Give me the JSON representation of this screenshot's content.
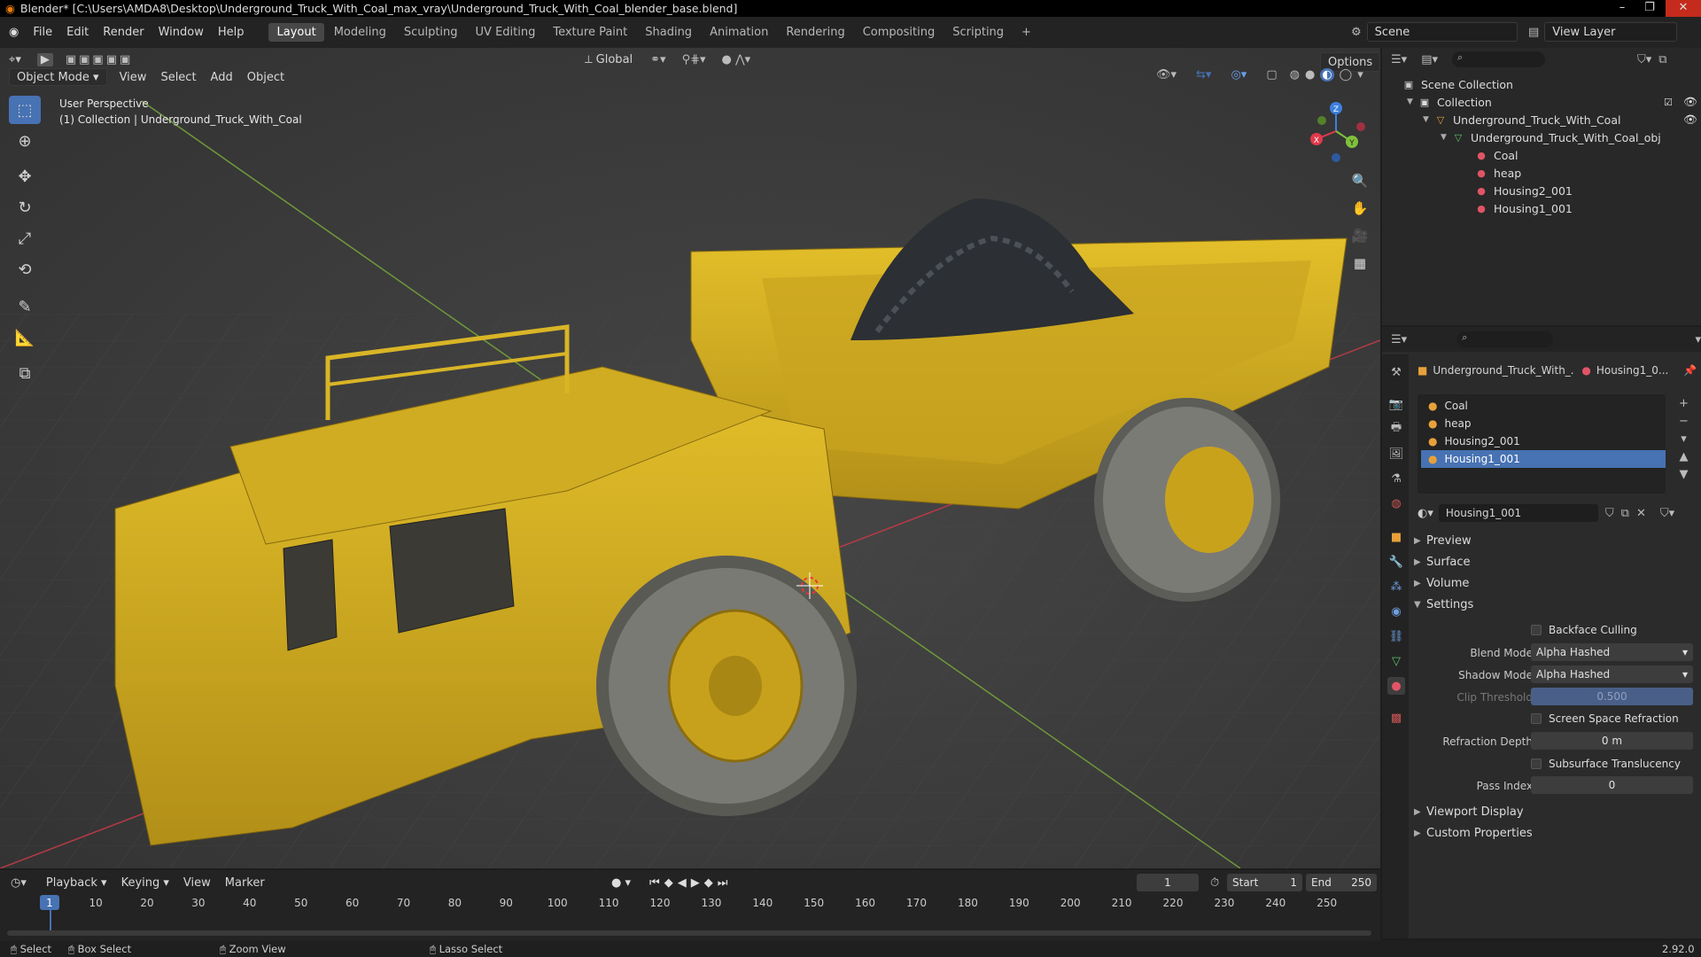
{
  "titlebar": {
    "title": "Blender* [C:\\Users\\AMDA8\\Desktop\\Underground_Truck_With_Coal_max_vray\\Underground_Truck_With_Coal_blender_base.blend]"
  },
  "menu": [
    "File",
    "Edit",
    "Render",
    "Window",
    "Help"
  ],
  "workspaces": [
    "Layout",
    "Modeling",
    "Sculpting",
    "UV Editing",
    "Texture Paint",
    "Shading",
    "Animation",
    "Rendering",
    "Compositing",
    "Scripting"
  ],
  "active_workspace": "Layout",
  "scene": "Scene",
  "view_layer": "View Layer",
  "viewport": {
    "mode": "Object Mode",
    "menus": [
      "View",
      "Select",
      "Add",
      "Object"
    ],
    "orientation": "Global",
    "options": "Options",
    "overlay_line1": "User Perspective",
    "overlay_line2": "(1) Collection | Underground_Truck_With_Coal",
    "gizmo": {
      "x": "X",
      "y": "Y",
      "z": "Z"
    }
  },
  "outliner": {
    "root": "Scene Collection",
    "collection": "Collection",
    "object": "Underground_Truck_With_Coal",
    "mesh": "Underground_Truck_With_Coal_obj",
    "materials": [
      "Coal",
      "heap",
      "Housing2_001",
      "Housing1_001"
    ]
  },
  "properties": {
    "object_name": "Underground_Truck_With_...",
    "material_short": "Housing1_0...",
    "slots": [
      "Coal",
      "heap",
      "Housing2_001",
      "Housing1_001"
    ],
    "selected_slot": "Housing1_001",
    "material_name": "Housing1_001",
    "panels": {
      "preview": "Preview",
      "surface": "Surface",
      "volume": "Volume",
      "settings": "Settings",
      "viewport_display": "Viewport Display",
      "custom_properties": "Custom Properties"
    },
    "settings": {
      "backface_culling": "Backface Culling",
      "blend_mode_label": "Blend Mode",
      "blend_mode": "Alpha Hashed",
      "shadow_mode_label": "Shadow Mode",
      "shadow_mode": "Alpha Hashed",
      "clip_threshold_label": "Clip Threshold",
      "clip_threshold": "0.500",
      "ssr": "Screen Space Refraction",
      "refraction_depth_label": "Refraction Depth",
      "refraction_depth": "0 m",
      "subsurface": "Subsurface Translucency",
      "pass_index_label": "Pass Index",
      "pass_index": "0"
    }
  },
  "timeline": {
    "menus": [
      "Playback",
      "Keying",
      "View",
      "Marker"
    ],
    "current_frame": "1",
    "start_label": "Start",
    "start": "1",
    "end_label": "End",
    "end": "250",
    "frame_labels": [
      "1",
      "10",
      "20",
      "30",
      "40",
      "50",
      "60",
      "70",
      "80",
      "90",
      "100",
      "110",
      "120",
      "130",
      "140",
      "150",
      "160",
      "170",
      "180",
      "190",
      "200",
      "210",
      "220",
      "230",
      "240",
      "250"
    ]
  },
  "statusbar": {
    "select": "Select",
    "box_select": "Box Select",
    "zoom_view": "Zoom View",
    "lasso_select": "Lasso Select",
    "version": "2.92.0"
  },
  "colors": {
    "accent": "#4772b3",
    "truck_yellow": "#d7b21e",
    "x_axis": "#e03a4a",
    "y_axis": "#7fc23a",
    "z_axis": "#3d7fe0"
  }
}
